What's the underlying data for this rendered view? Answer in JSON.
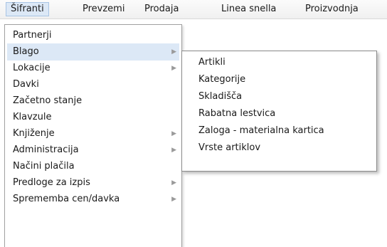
{
  "menubar": {
    "items": [
      "Šifranti",
      "Prevzemi",
      "Prodaja",
      "Linea snella",
      "Proizvodnja"
    ]
  },
  "dropdown": {
    "items": [
      {
        "label": "Partnerji",
        "submenu": false
      },
      {
        "label": "Blago",
        "submenu": true
      },
      {
        "label": "Lokacije",
        "submenu": true
      },
      {
        "label": "Davki",
        "submenu": false
      },
      {
        "label": "Začetno stanje",
        "submenu": false
      },
      {
        "label": "Klavzule",
        "submenu": false
      },
      {
        "label": "Knjiženje",
        "submenu": true
      },
      {
        "label": "Administracija",
        "submenu": true
      },
      {
        "label": "Načini plačila",
        "submenu": false
      },
      {
        "label": "Predloge za izpis",
        "submenu": true
      },
      {
        "label": "Sprememba cen/davka",
        "submenu": true
      }
    ],
    "submenu_arrow": "▶"
  },
  "submenu": {
    "items": [
      "Artikli",
      "Kategorije",
      "Skladišča",
      "Rabatna lestvica",
      "Zaloga - materialna kartica",
      "Vrste artiklov"
    ]
  }
}
